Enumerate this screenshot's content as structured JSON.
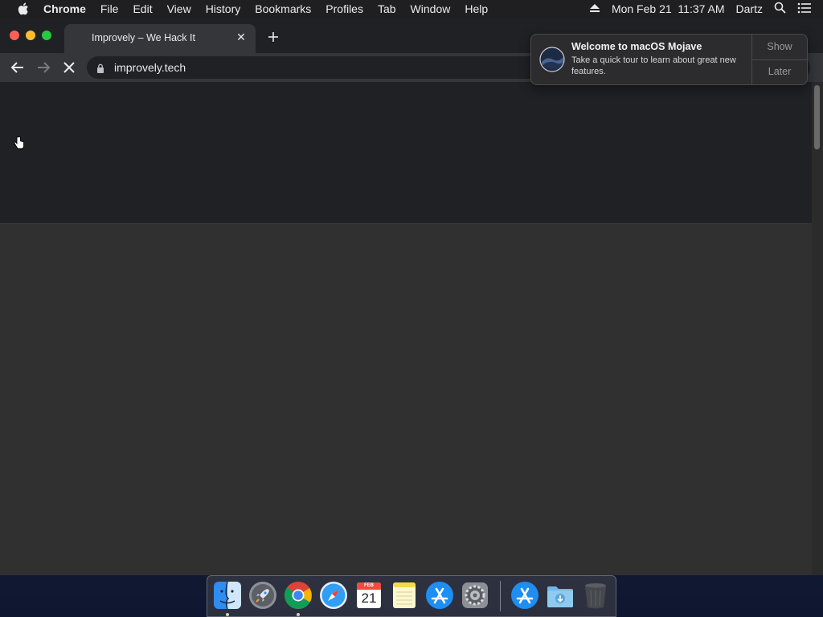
{
  "menubar": {
    "apple_icon": "apple-logo-icon",
    "app_name": "Chrome",
    "menus": [
      "File",
      "Edit",
      "View",
      "History",
      "Bookmarks",
      "Profiles",
      "Tab",
      "Window",
      "Help"
    ],
    "datetime": "Mon Feb 21  11:37 AM",
    "user": "Dartz",
    "icons": [
      "eject-icon",
      "spotlight-search-icon",
      "notification-center-icon"
    ]
  },
  "browser": {
    "tab": {
      "title": "Improvely – We Hack It",
      "close_icon": "close-icon"
    },
    "new_tab_icon": "plus-icon",
    "toolbar": {
      "back_icon": "arrow-left-icon",
      "forward_icon": "arrow-right-icon",
      "stop_icon": "stop-loading-x-icon"
    },
    "omnibox": {
      "lock_icon": "lock-icon",
      "url": "improvely.tech"
    }
  },
  "notification": {
    "title": "Welcome to macOS Mojave",
    "body": "Take a quick tour to learn about great new features.",
    "show_label": "Show",
    "later_label": "Later",
    "icon": "macos-mojave-icon"
  },
  "dock": {
    "items": [
      {
        "name": "Finder",
        "icon": "finder-icon",
        "running": true
      },
      {
        "name": "Launchpad",
        "icon": "launchpad-rocket-icon",
        "running": false
      },
      {
        "name": "Google Chrome",
        "icon": "chrome-icon",
        "running": true
      },
      {
        "name": "Safari",
        "icon": "safari-compass-icon",
        "running": false
      },
      {
        "name": "Calendar",
        "icon": "calendar-icon",
        "running": false,
        "month": "FEB",
        "day": "21"
      },
      {
        "name": "Notes",
        "icon": "notes-icon",
        "running": false
      },
      {
        "name": "App Store",
        "icon": "app-store-icon",
        "running": false
      },
      {
        "name": "System Preferences",
        "icon": "gear-icon",
        "running": false
      },
      {
        "name": "App Store",
        "icon": "app-store-icon",
        "running": false
      },
      {
        "name": "Downloads",
        "icon": "downloads-folder-icon",
        "running": false
      },
      {
        "name": "Trash",
        "icon": "trash-icon",
        "running": false
      }
    ]
  },
  "colors": {
    "menubar_bg": "#1f1f21",
    "tab_active_bg": "#35363a",
    "page_dark_bg": "#202124",
    "page_body_bg": "#303030"
  }
}
